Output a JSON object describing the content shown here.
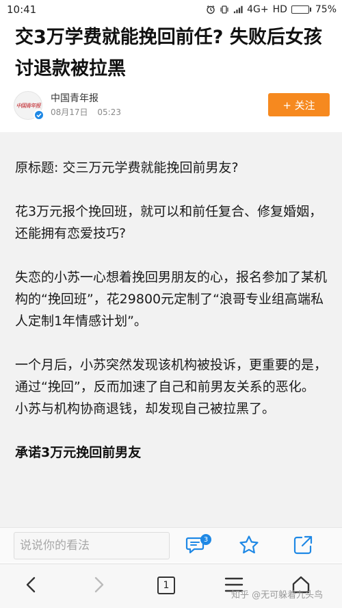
{
  "status": {
    "time": "10:41",
    "network": "4G+",
    "hd": "HD",
    "battery": "75%",
    "battery_level": 0.75
  },
  "article": {
    "title": "交3万学费就能挽回前任? 失败后女孩讨退款被拉黑",
    "author": "中国青年报",
    "avatar_text": "中国青年报",
    "date": "08月17日",
    "time": "05:23",
    "follow_label": "+ 关注",
    "paragraphs": [
      "原标题: 交三万元学费就能挽回前男友?",
      "花3万元报个挽回班，就可以和前任复合、修复婚姻，还能拥有恋爱技巧?",
      "失恋的小苏一心想着挽回男朋友的心，报名参加了某机构的“挽回班”，花29800元定制了“浪哥专业组高端私人定制1年情感计划”。",
      "一个月后，小苏突然发现该机构被投诉，更重要的是，通过“挽回”，反而加速了自己和前男友关系的恶化。小苏与机构协商退钱，却发现自己被拉黑了。"
    ],
    "subheading": "承诺3万元挽回前男友"
  },
  "comment_bar": {
    "placeholder": "说说你的看法",
    "comment_count": "3"
  },
  "nav": {
    "tab_count": "1",
    "watermark": "知乎 @无可躲着九头鸟"
  },
  "colors": {
    "accent": "#f6891f",
    "icon_blue": "#1e88e5",
    "content_bg": "#f2f2f2"
  },
  "icons": [
    "alarm-icon",
    "vibrate-icon",
    "signal-icon",
    "battery-icon",
    "verified-icon",
    "comment-icon",
    "star-icon",
    "share-icon",
    "back-icon",
    "forward-icon",
    "menu-icon",
    "home-icon"
  ]
}
